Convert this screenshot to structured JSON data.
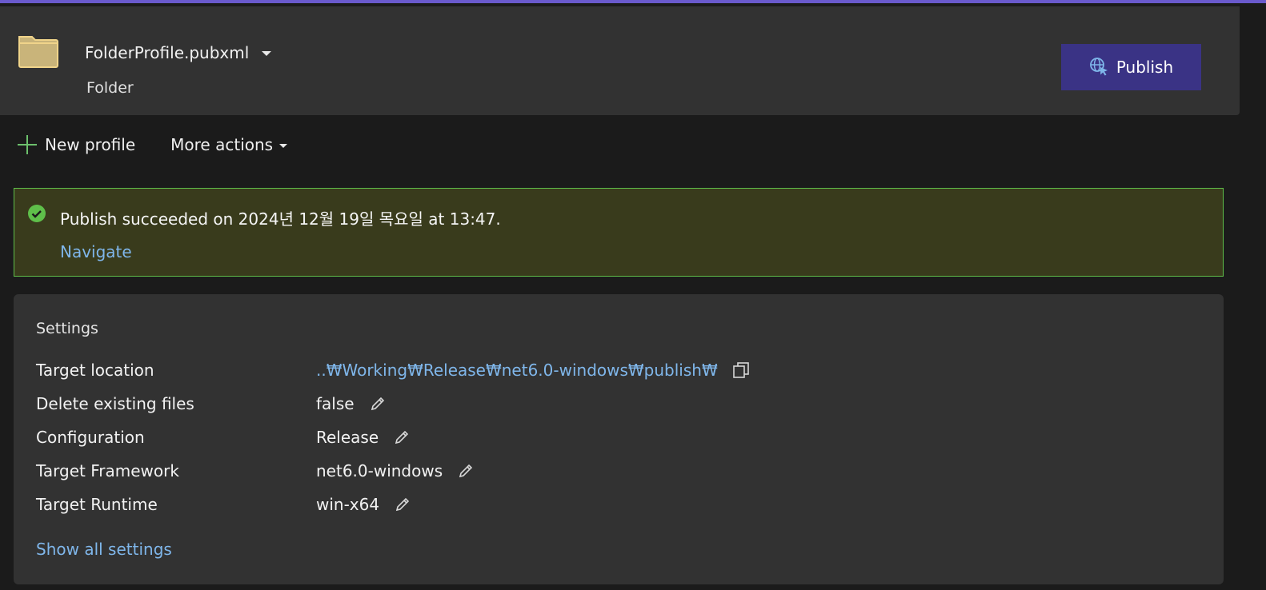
{
  "header": {
    "profile_name": "FolderProfile.pubxml",
    "profile_type": "Folder",
    "publish_label": "Publish"
  },
  "actions": {
    "new_profile": "New profile",
    "more_actions": "More actions"
  },
  "banner": {
    "message": "Publish succeeded on 2024년 12월 19일 목요일 at 13:47.",
    "navigate": "Navigate",
    "status_color": "#5fbf4a"
  },
  "settings": {
    "title": "Settings",
    "rows": [
      {
        "label": "Target location",
        "value": "..₩Working₩Release₩net6.0-windows₩publish₩",
        "action_icon": "copy-icon"
      },
      {
        "label": "Delete existing files",
        "value": "false",
        "action_icon": "edit-icon"
      },
      {
        "label": "Configuration",
        "value": "Release",
        "action_icon": "edit-icon"
      },
      {
        "label": "Target Framework",
        "value": "net6.0-windows",
        "action_icon": "edit-icon"
      },
      {
        "label": "Target Runtime",
        "value": "win-x64",
        "action_icon": "edit-icon"
      }
    ],
    "show_all": "Show all settings"
  },
  "colors": {
    "accent": "#6a5acd",
    "publish_button": "#3a3385",
    "link": "#7fb6ea",
    "success_bg": "#393b1c"
  }
}
